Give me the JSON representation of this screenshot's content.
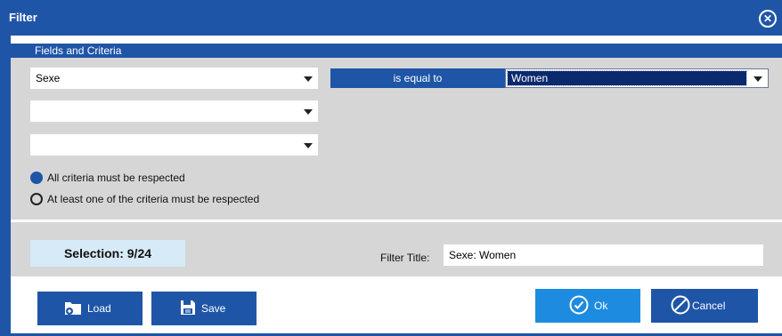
{
  "window": {
    "title": "Filter"
  },
  "section": {
    "header": "Fields and Criteria"
  },
  "criteria": {
    "row1": {
      "field": "Sexe",
      "operator": "is equal to",
      "value": "Women"
    },
    "row2": {
      "field": ""
    },
    "row3": {
      "field": ""
    }
  },
  "logic": {
    "all_label": "All criteria must be respected",
    "any_label": "At least one of the criteria must be respected",
    "selected": "all"
  },
  "selection": {
    "text": "Selection: 9/24"
  },
  "filter_title": {
    "label": "Filter Title:",
    "value": "Sexe: Women"
  },
  "buttons": {
    "load": "Load",
    "save": "Save",
    "ok": "Ok",
    "cancel": "Cancel"
  },
  "colors": {
    "primary": "#1f55a7",
    "accent": "#1d8ce0",
    "panel": "#d6d6d6",
    "selection_bg": "#d6eaf8"
  },
  "icons": {
    "close": "close-circle-icon",
    "load": "folder-load-icon",
    "save": "floppy-disk-icon",
    "ok": "checkmark-circle-icon",
    "cancel": "cancel-circle-icon"
  }
}
